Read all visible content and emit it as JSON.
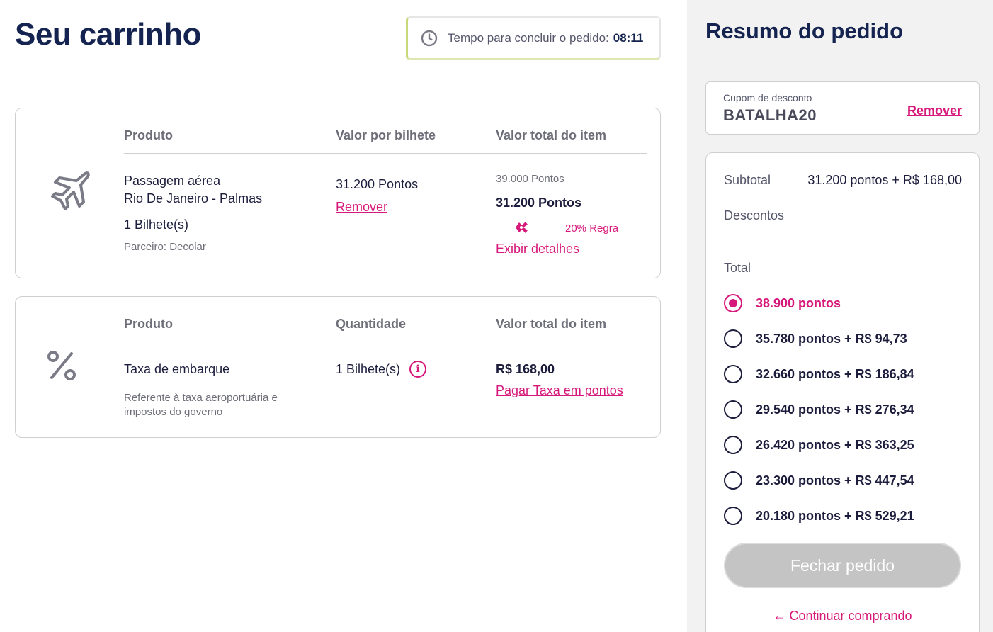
{
  "cart": {
    "title": "Seu carrinho",
    "timer": {
      "label": "Tempo para concluir o pedido:",
      "value": "08:11",
      "icon": "clock-icon"
    }
  },
  "flight_item": {
    "icon": "airplane-icon",
    "headers": {
      "product": "Produto",
      "unit_price": "Valor por bilhete",
      "total": "Valor total do item"
    },
    "product_type": "Passagem aérea",
    "route": "Rio De Janeiro - Palmas",
    "tickets": "1 Bilhete(s)",
    "partner": "Parceiro: Decolar",
    "unit_price": "31.200 Pontos",
    "remove_label": "Remover",
    "original_total": "39.000 Pontos",
    "total": "31.200 Pontos",
    "badge_icon": "discount-rule-icon",
    "badge_text": "20% Regra",
    "details_label": "Exibir detalhes"
  },
  "tax_item": {
    "icon": "percent-icon",
    "headers": {
      "product": "Produto",
      "quantity": "Quantidade",
      "total": "Valor total do item"
    },
    "product": "Taxa de embarque",
    "description_line1": "Referente à taxa aeroportuária e",
    "description_line2": "impostos do governo",
    "quantity": "1 Bilhete(s)",
    "info_icon": "info-icon",
    "info_glyph": "i",
    "total": "R$ 168,00",
    "pay_points_label": "Pagar Taxa em pontos"
  },
  "summary": {
    "title": "Resumo do pedido",
    "coupon": {
      "label": "Cupom de desconto",
      "code": "BATALHA20",
      "remove_label": "Remover"
    },
    "subtotal_label": "Subtotal",
    "subtotal_value": "31.200 pontos + R$ 168,00",
    "discounts_label": "Descontos",
    "total_label": "Total",
    "options": [
      {
        "label": "38.900 pontos",
        "selected": true
      },
      {
        "label": "35.780 pontos + R$ 94,73",
        "selected": false
      },
      {
        "label": "32.660 pontos + R$ 186,84",
        "selected": false
      },
      {
        "label": "29.540 pontos + R$ 276,34",
        "selected": false
      },
      {
        "label": "26.420 pontos + R$ 363,25",
        "selected": false
      },
      {
        "label": "23.300 pontos + R$ 447,54",
        "selected": false
      },
      {
        "label": "20.180 pontos + R$ 529,21",
        "selected": false
      }
    ],
    "checkout_label": "Fechar pedido",
    "continue_arrow": "←",
    "continue_label": "Continuar comprando"
  },
  "colors": {
    "accent": "#d6197a",
    "title": "#14234f",
    "disabled": "#c4c4c4"
  }
}
